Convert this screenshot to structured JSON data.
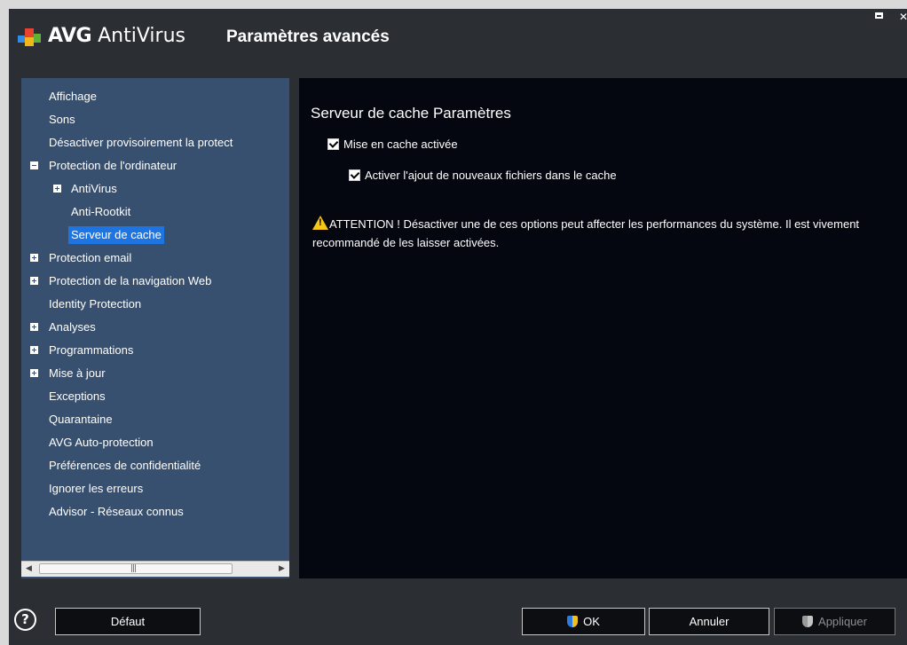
{
  "window": {
    "brand_bold": "AVG",
    "brand_rest": " AntiVirus",
    "title": "Paramètres avancés",
    "controls": [
      "maximize-icon",
      "close-icon"
    ]
  },
  "tree": {
    "items": [
      {
        "label": "Affichage",
        "level": 0,
        "expander": "none"
      },
      {
        "label": "Sons",
        "level": 0,
        "expander": "none"
      },
      {
        "label": "Désactiver provisoirement la protect",
        "level": 0,
        "expander": "none"
      },
      {
        "label": "Protection de l'ordinateur",
        "level": 0,
        "expander": "minus"
      },
      {
        "label": "AntiVirus",
        "level": 1,
        "expander": "plus"
      },
      {
        "label": "Anti-Rootkit",
        "level": 1,
        "expander": "none"
      },
      {
        "label": "Serveur de cache",
        "level": 1,
        "expander": "none",
        "selected": true
      },
      {
        "label": "Protection email",
        "level": 0,
        "expander": "plus"
      },
      {
        "label": "Protection de la navigation Web",
        "level": 0,
        "expander": "plus"
      },
      {
        "label": "Identity Protection",
        "level": 0,
        "expander": "none"
      },
      {
        "label": "Analyses",
        "level": 0,
        "expander": "plus"
      },
      {
        "label": "Programmations",
        "level": 0,
        "expander": "plus"
      },
      {
        "label": "Mise à jour",
        "level": 0,
        "expander": "plus"
      },
      {
        "label": "Exceptions",
        "level": 0,
        "expander": "none"
      },
      {
        "label": "Quarantaine",
        "level": 0,
        "expander": "none"
      },
      {
        "label": "AVG Auto-protection",
        "level": 0,
        "expander": "none"
      },
      {
        "label": "Préférences de confidentialité",
        "level": 0,
        "expander": "none"
      },
      {
        "label": "Ignorer les erreurs",
        "level": 0,
        "expander": "none"
      },
      {
        "label": "Advisor - Réseaux connus",
        "level": 0,
        "expander": "none"
      }
    ],
    "scrollbar": {
      "left_arrow": "◀",
      "right_arrow": "▶",
      "grip": "|||"
    }
  },
  "content": {
    "title": "Serveur de cache Paramètres",
    "checkbox_cache_label": "Mise en cache activée",
    "checkbox_cache_checked": true,
    "checkbox_add_label": "Activer l'ajout de nouveaux fichiers dans le cache",
    "checkbox_add_checked": true,
    "warning_text": "ATTENTION ! Désactiver une de ces options peut affecter les performances du système. Il est vivement recommandé de les laisser activées."
  },
  "footer": {
    "help": "?",
    "default_label": "Défaut",
    "ok_label": "OK",
    "cancel_label": "Annuler",
    "apply_label": "Appliquer",
    "apply_enabled": false
  },
  "colors": {
    "window_bg": "#2b2e33",
    "tree_bg": "#37506f",
    "selection": "#1e74e0",
    "content_bg": "#04070f",
    "warning": "#f5c518"
  }
}
